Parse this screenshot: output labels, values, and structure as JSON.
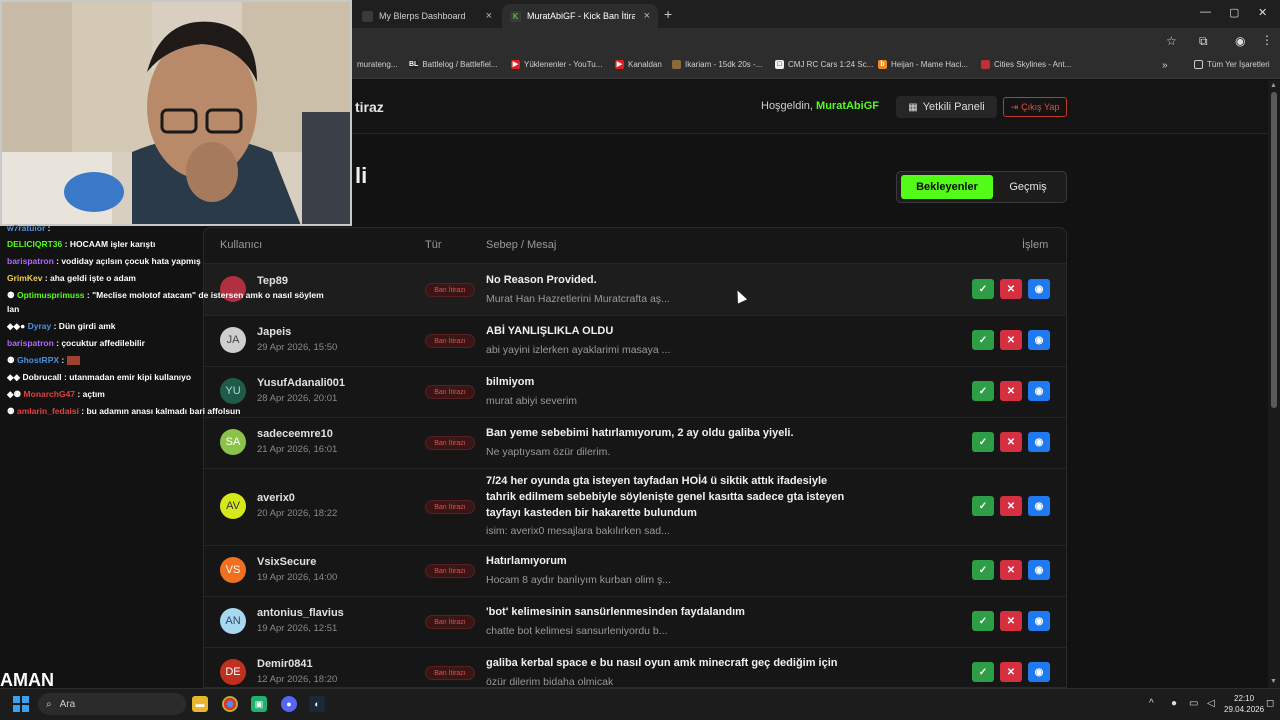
{
  "browser": {
    "tabs": [
      {
        "title": "My Blerps Dashboard",
        "close": "×"
      },
      {
        "title": "MuratAbiGF - Kick Ban İtiraz Sis",
        "close": "×"
      }
    ],
    "new_tab": "+",
    "window_controls": {
      "minimize": "—",
      "maximize": "▢",
      "close": "✕"
    },
    "bookmarks": [
      {
        "label": "murateng..."
      },
      {
        "label": "Battlelog / Battlefiel...",
        "icon": "BL"
      },
      {
        "label": "Yüklenenler - YouTu..."
      },
      {
        "label": "Kanaldan"
      },
      {
        "label": "Ikariam - 15dk 20s -..."
      },
      {
        "label": "CMJ RC Cars 1:24 Sc..."
      },
      {
        "label": "Heijan - Mame Haci..."
      },
      {
        "label": "Cities Skylines - Ant..."
      }
    ],
    "bookmarks_overflow": "»",
    "all_bookmarks": "Tüm Yer İşaretleri"
  },
  "header": {
    "title_fragment": "tiraz",
    "welcome_prefix": "Hoşgeldin,",
    "username": "MuratAbiGF",
    "admin_panel": "Yetkili Paneli",
    "logout": "Çıkış Yap"
  },
  "page": {
    "heading_fragment": "li",
    "tabs": {
      "pending": "Bekleyenler",
      "history": "Geçmiş"
    }
  },
  "table": {
    "headers": {
      "user": "Kullanıcı",
      "type": "Tür",
      "reason": "Sebep / Mesaj",
      "action": "İşlem"
    },
    "rows": [
      {
        "initials": "",
        "user": "Tep89",
        "date": "",
        "badge": "Ban İtirazı",
        "reason": "No Reason Provided.",
        "message": "Murat Han Hazretlerini Muratcrafta aş..."
      },
      {
        "initials": "JA",
        "user": "Japeis",
        "date": "29 Apr 2026, 15:50",
        "badge": "Ban İtirazı",
        "reason": "ABİ YANLIŞLIKLA OLDU",
        "message": "abi yayini izlerken ayaklarimi masaya ..."
      },
      {
        "initials": "YU",
        "user": "YusufAdanali001",
        "date": "28 Apr 2026, 20:01",
        "badge": "Ban İtirazı",
        "reason": "bilmiyom",
        "message": "murat abiyi severim"
      },
      {
        "initials": "SA",
        "user": "sadeceemre10",
        "date": "21 Apr 2026, 16:01",
        "badge": "Ban İtirazı",
        "reason": "Ban yeme sebebimi hatırlamıyorum, 2 ay oldu galiba yiyeli.",
        "message": "Ne yaptıysam özür dilerim."
      },
      {
        "initials": "AV",
        "user": "averix0",
        "date": "20 Apr 2026, 18:22",
        "badge": "Ban İtirazı",
        "reason": "7/24 her oyunda gta isteyen tayfadan HOİ4 ü siktik attık ifadesiyle tahrik edilmem sebebiyle söyleniște genel kasıtta sadece gta isteyen tayfayı kasteden bir hakarette bulundum",
        "message": "isim: averix0 mesajlara bakılırken sad..."
      },
      {
        "initials": "VS",
        "user": "VsixSecure",
        "date": "19 Apr 2026, 14:00",
        "badge": "Ban İtirazı",
        "reason": "Hatırlamıyorum",
        "message": "Hocam 8 aydır banlıyım kurban olim ş..."
      },
      {
        "initials": "AN",
        "user": "antonius_flavius",
        "date": "19 Apr 2026, 12:51",
        "badge": "Ban İtirazı",
        "reason": "'bot' kelimesinin sansürlenmesinden faydalandım",
        "message": "chatte bot kelimesi sansurleniyordu b..."
      },
      {
        "initials": "DE",
        "user": "Demir0841",
        "date": "12 Apr 2026, 18:20",
        "badge": "Ban İtirazı",
        "reason": "galiba kerbal space e bu nasıl oyun amk minecraft geç dediğim için",
        "message": "özür dilerim bidaha olmicak"
      }
    ],
    "actions": {
      "approve": "✓",
      "reject": "✕",
      "view": "👁"
    }
  },
  "chat": {
    "lines": [
      {
        "name": "w7ratuior",
        "text": ":",
        "color": "#4a90e2"
      },
      {
        "name": "DELICIQRT36",
        "text": ": HOCAAM işler karıştı",
        "color": "#53fc18"
      },
      {
        "name": "barispatron",
        "text": ": vodiday açılsın çocuk hata yapmış",
        "color": "#b266ff"
      },
      {
        "name": "GrimKev",
        "text": ": aha geldi işte o adam",
        "color": "#f0d050"
      },
      {
        "name": "Optimusprimuss",
        "text": ": \"Meclise molotof atacam\" de istersen amk o nasıl söylem",
        "color": "#53fc18"
      },
      {
        "name": "",
        "text": "lan",
        "color": "#ffffff"
      },
      {
        "name": "Dyray",
        "text": ": Dün girdi amk",
        "color": "#4a90e2"
      },
      {
        "name": "barispatron",
        "text": ": çocuktur affedilebilir",
        "color": "#b266ff"
      },
      {
        "name": "GhostRPX",
        "text": ":",
        "color": "#4a90e2"
      },
      {
        "name": "Dobrucall",
        "text": ": utanmadan emir kipi kullanıyo",
        "color": "#ffffff"
      },
      {
        "name": "MonarchG47",
        "text": ": açtım",
        "color": "#e04040"
      },
      {
        "name": "amlarin_fedaisi",
        "text": ": bu adamın anası kalmadı bari affolsun",
        "color": "#e04040"
      }
    ],
    "banner": "AMAN"
  },
  "taskbar": {
    "search": "Ara",
    "time": "22:10",
    "date": "29.04.2026"
  },
  "colors": {
    "accent": "#53fc18",
    "danger": "#d63040",
    "info": "#1f7af0",
    "success": "#2e9e46"
  }
}
